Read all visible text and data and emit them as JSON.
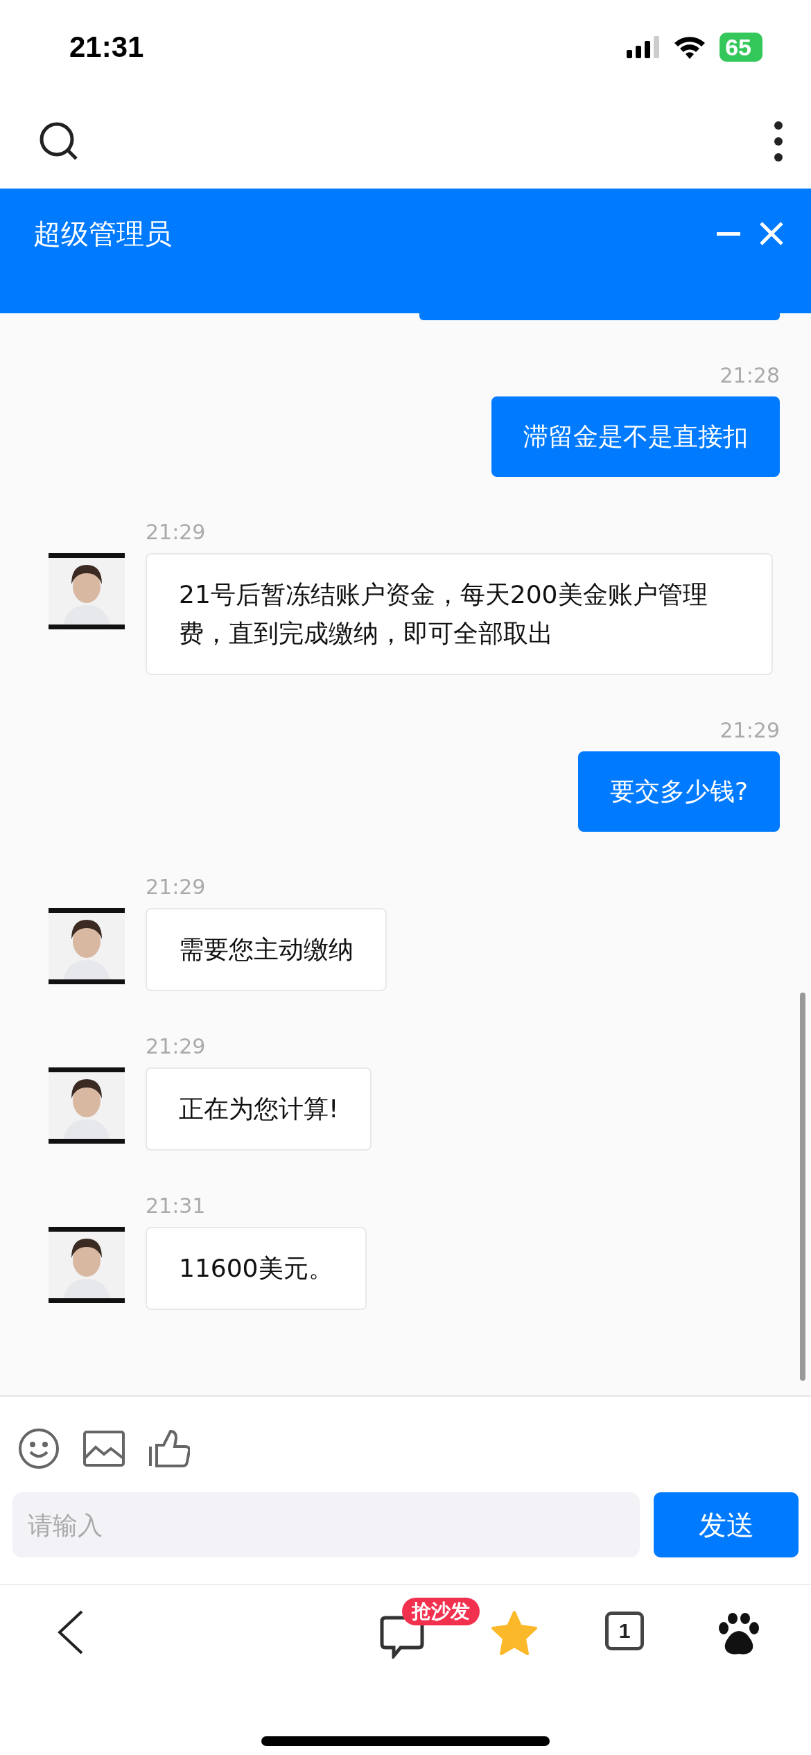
{
  "status_bar": {
    "time": "21:31",
    "battery": "65"
  },
  "chat_header": {
    "title": "超级管理员"
  },
  "messages": [
    {
      "kind": "outgoing",
      "time": "21:28",
      "text": "滞留金是不是直接扣"
    },
    {
      "kind": "incoming",
      "time": "21:29",
      "text": "21号后暂冻结账户资金，每天200美金账户管理费，直到完成缴纳，即可全部取出"
    },
    {
      "kind": "outgoing",
      "time": "21:29",
      "text": "要交多少钱?"
    },
    {
      "kind": "incoming",
      "time": "21:29",
      "text": "需要您主动缴纳"
    },
    {
      "kind": "incoming",
      "time": "21:29",
      "text": "正在为您计算!"
    },
    {
      "kind": "incoming",
      "time": "21:31",
      "text": "11600美元。"
    }
  ],
  "composer": {
    "placeholder": "请输入",
    "send": "发送"
  },
  "bottom_nav": {
    "badge": "抢沙发",
    "tab_count": "1"
  }
}
